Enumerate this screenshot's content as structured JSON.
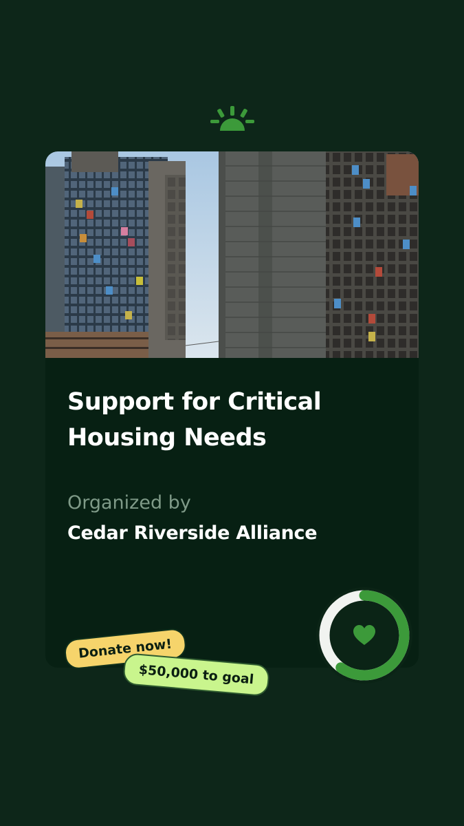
{
  "brand": {
    "logo_icon": "sunrise-logo-icon",
    "accent": "#3c9a3a"
  },
  "campaign": {
    "title": "Support for Critical Housing Needs",
    "organizer_label": "Organized by",
    "organizer_name": "Cedar Riverside Alliance",
    "image": "high-rise-apartment-towers-photo",
    "progress_fraction": 0.6,
    "progress_icon": "heart-icon"
  },
  "stickers": {
    "donate_label": "Donate now!",
    "goal_label": "$50,000 to goal"
  },
  "colors": {
    "background": "#0d2619",
    "card": "#072013",
    "donate_sticker": "#f6d46b",
    "goal_sticker": "#c9f58d"
  }
}
